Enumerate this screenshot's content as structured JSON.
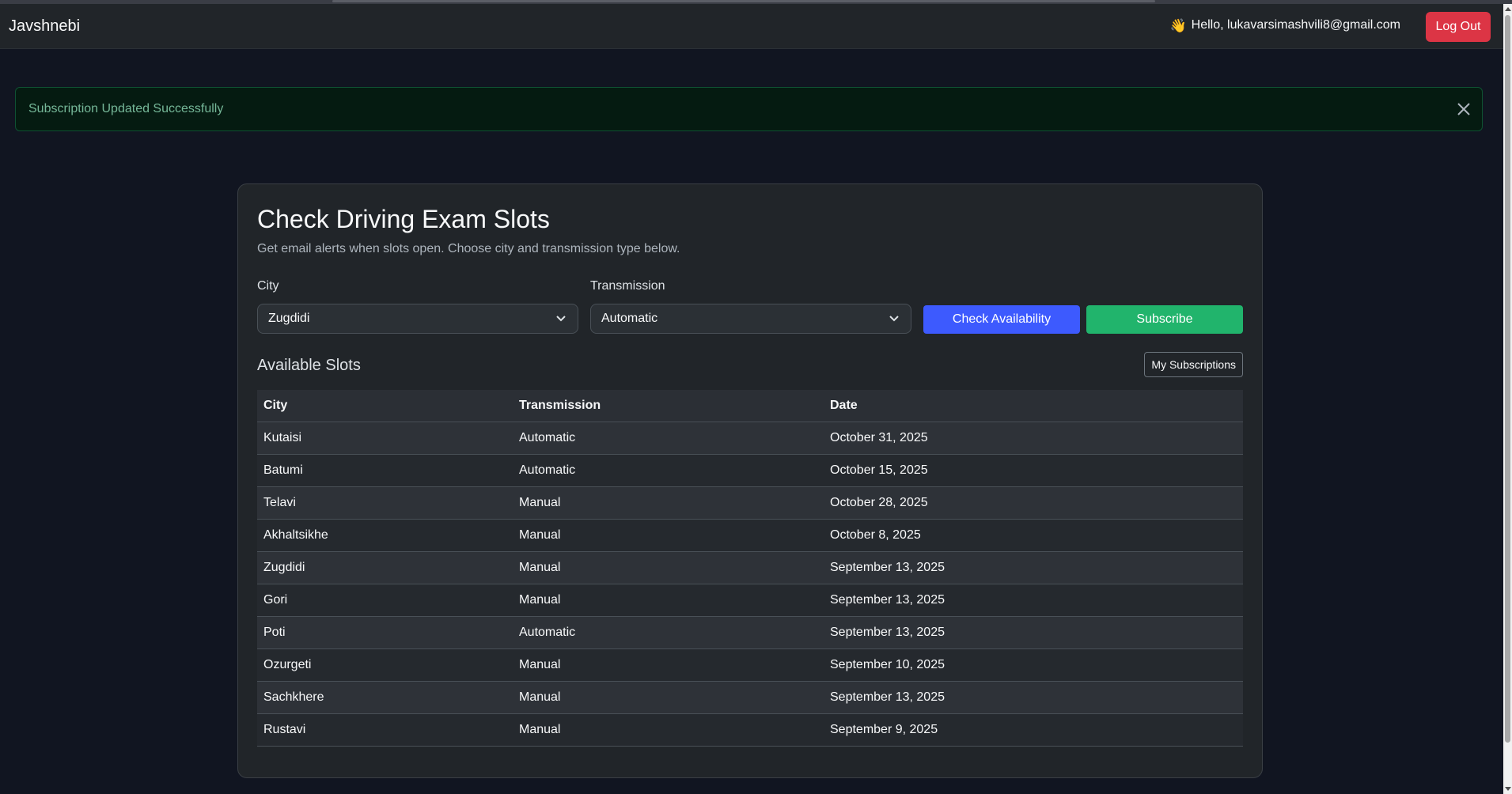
{
  "navbar": {
    "brand": "Javshnebi",
    "greeting": "Hello, lukavarsimashvili8@gmail.com",
    "logout_label": "Log Out"
  },
  "alert": {
    "message": "Subscription Updated Successfully"
  },
  "card": {
    "title": "Check Driving Exam Slots",
    "subtitle": "Get email alerts when slots open. Choose city and transmission type below.",
    "city_label": "City",
    "city_value": "Zugdidi",
    "transmission_label": "Transmission",
    "transmission_value": "Automatic",
    "check_label": "Check Availability",
    "subscribe_label": "Subscribe",
    "slots_title": "Available Slots",
    "my_subscriptions_label": "My Subscriptions"
  },
  "table": {
    "headers": [
      "City",
      "Transmission",
      "Date"
    ],
    "rows": [
      [
        "Kutaisi",
        "Automatic",
        "October 31, 2025"
      ],
      [
        "Batumi",
        "Automatic",
        "October 15, 2025"
      ],
      [
        "Telavi",
        "Manual",
        "October 28, 2025"
      ],
      [
        "Akhaltsikhe",
        "Manual",
        "October 8, 2025"
      ],
      [
        "Zugdidi",
        "Manual",
        "September 13, 2025"
      ],
      [
        "Gori",
        "Manual",
        "September 13, 2025"
      ],
      [
        "Poti",
        "Automatic",
        "September 13, 2025"
      ],
      [
        "Ozurgeti",
        "Manual",
        "September 10, 2025"
      ],
      [
        "Sachkhere",
        "Manual",
        "September 13, 2025"
      ],
      [
        "Rustavi",
        "Manual",
        "September 9, 2025"
      ]
    ]
  },
  "icons": {
    "greeting": "waving-hand-icon",
    "alert_close": "close-icon",
    "select": "chevron-down-icon"
  },
  "colors": {
    "logout": "#dc3545",
    "check": "#3d5afe",
    "subscribe": "#21b46c",
    "alert_text": "#75b798"
  }
}
